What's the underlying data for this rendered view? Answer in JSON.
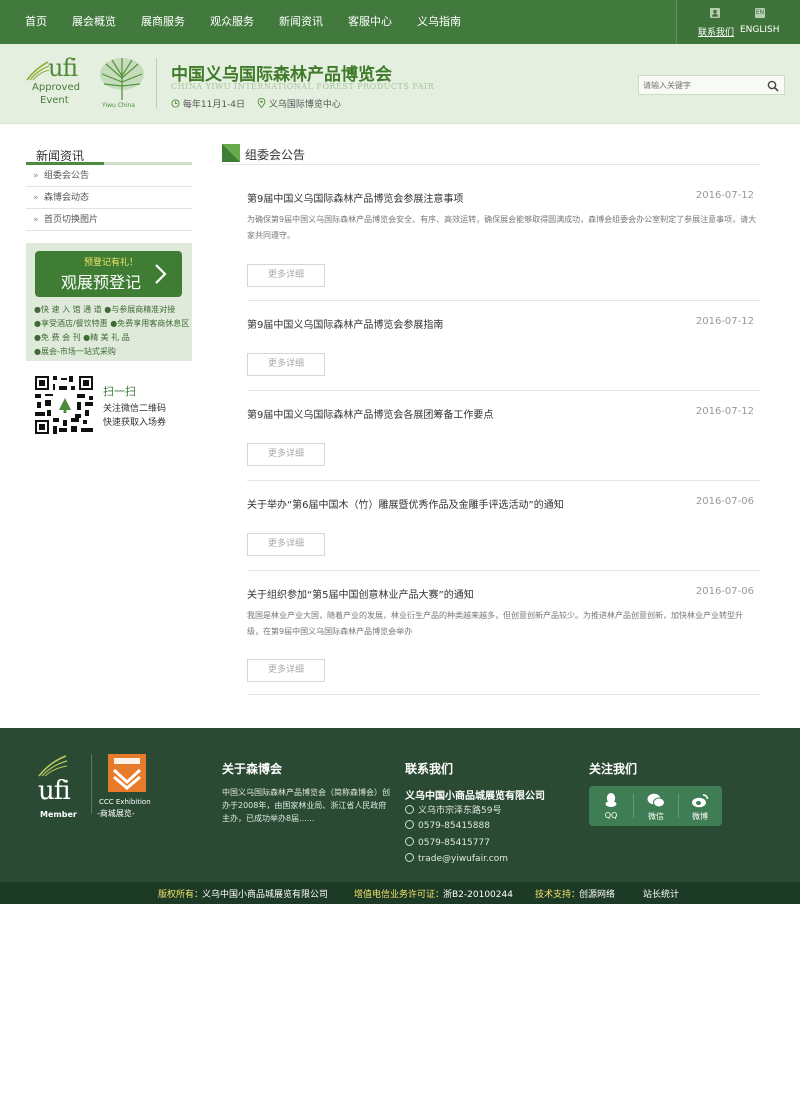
{
  "nav": {
    "items": [
      "首页",
      "展会概览",
      "展商服务",
      "观众服务",
      "新闻资讯",
      "客服中心",
      "义乌指南"
    ],
    "contact": "联系我们",
    "english": "ENGLISH",
    "en_badge": "EN"
  },
  "header": {
    "ufi_big": "ufi",
    "ufi_approved": "Approved",
    "ufi_event": "Event",
    "logo_label": "Yiwu China",
    "title": "中国义乌国际森林产品博览会",
    "title_en": "CHINA YIWU INTERNATIONAL FOREST PRODUCTS FAIR",
    "date": "每年11月1-4日",
    "venue": "义乌国际博览中心",
    "search_placeholder": "请输入关键字"
  },
  "sidebar": {
    "heading": "新闻资讯",
    "items": [
      "组委会公告",
      "森博会动态",
      "首页切换图片"
    ]
  },
  "prereg": {
    "tag": "预登记有礼！",
    "label": "观展预登记",
    "features": [
      "●快 速 入 馆 通 道  ●与参展商精准对接",
      "●享受酒店/餐饮特惠  ●免费享用客商休息区",
      "●免 费 会 刊  ●精 美 礼 品",
      "●展会-市场一站式采购"
    ]
  },
  "qr": {
    "title": "扫一扫",
    "line1": "关注微信二维码",
    "line2": "快速获取入场券"
  },
  "section": {
    "title": "组委会公告"
  },
  "articles": [
    {
      "title": "第9届中国义乌国际森林产品博览会参展注意事项",
      "date": "2016-07-12",
      "excerpt": "为确保第9届中国义乌国际森林产品博览会安全、有序、高效运转，确保展会能够取得圆满成功，森博会组委会办公室制定了参展注意事项，请大家共同遵守。",
      "more": "更多详细"
    },
    {
      "title": "第9届中国义乌国际森林产品博览会参展指南",
      "date": "2016-07-12",
      "excerpt": "",
      "more": "更多详细"
    },
    {
      "title": "第9届中国义乌国际森林产品博览会各展团筹备工作要点",
      "date": "2016-07-12",
      "excerpt": "",
      "more": "更多详细"
    },
    {
      "title": "关于举办“第6届中国木（竹）雕展暨优秀作品及金雕手评选活动”的通知",
      "date": "2016-07-06",
      "excerpt": "",
      "more": "更多详细"
    },
    {
      "title": "关于组织参加“第5届中国创意林业产品大赛”的通知",
      "date": "2016-07-06",
      "excerpt": "我国是林业产业大国，随着产业的发展，林业衍生产品的种类越来越多，但创意创新产品较少。为推进林产品创意创新，加快林业产业转型升级，在第9届中国义乌国际森林产品博览会举办",
      "more": "更多详细"
    }
  ],
  "footer": {
    "ufi": "ufi",
    "member": "Member",
    "ccc_line1": "CCC Exhibition",
    "ccc_line2": "-商城展览-",
    "about_heading": "关于森博会",
    "about_text": "中国义乌国际森林产品博览会（简称森博会）创办于2008年，由国家林业局、浙江省人民政府主办，已成功举办8届......",
    "contact_heading": "联系我们",
    "company": "义乌中国小商品城展览有限公司",
    "address": "义乌市宗泽东路59号",
    "phone1": "0579-85415888",
    "phone2": "0579-85415777",
    "email": "trade@yiwufair.com",
    "follow_heading": "关注我们",
    "social": [
      "QQ",
      "微信",
      "微博"
    ]
  },
  "copyright": {
    "owner_label": "版权所有：",
    "owner": "义乌中国小商品城展览有限公司",
    "license_label": "增值电信业务许可证：",
    "license": "浙B2-20100244",
    "tech_label": "技术支持：",
    "tech": "创源网络",
    "stats": "站长统计"
  },
  "colors": {
    "brand_green": "#427a3e",
    "footer_green": "#2a4a34",
    "accent_orange": "#e77b2b"
  }
}
